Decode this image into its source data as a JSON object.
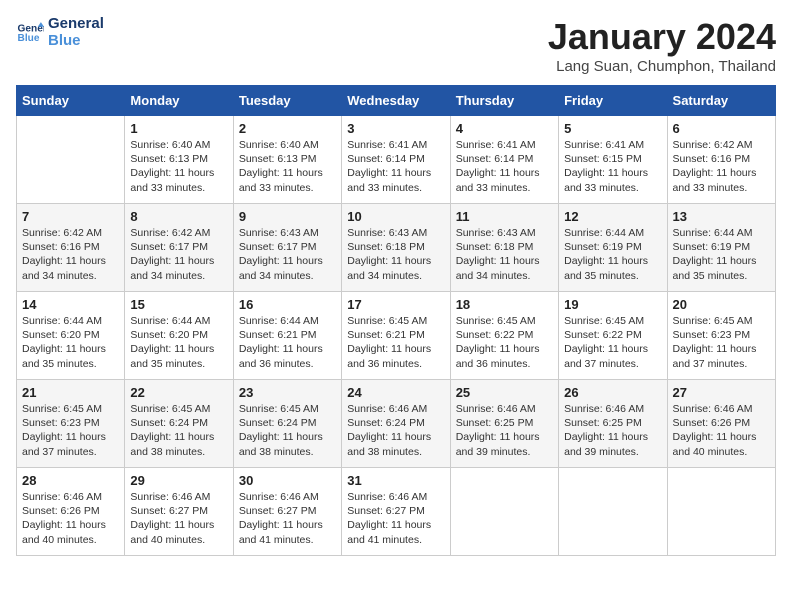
{
  "header": {
    "logo_line1": "General",
    "logo_line2": "Blue",
    "month_year": "January 2024",
    "location": "Lang Suan, Chumphon, Thailand"
  },
  "weekdays": [
    "Sunday",
    "Monday",
    "Tuesday",
    "Wednesday",
    "Thursday",
    "Friday",
    "Saturday"
  ],
  "weeks": [
    [
      {
        "day": "",
        "text": ""
      },
      {
        "day": "1",
        "text": "Sunrise: 6:40 AM\nSunset: 6:13 PM\nDaylight: 11 hours\nand 33 minutes."
      },
      {
        "day": "2",
        "text": "Sunrise: 6:40 AM\nSunset: 6:13 PM\nDaylight: 11 hours\nand 33 minutes."
      },
      {
        "day": "3",
        "text": "Sunrise: 6:41 AM\nSunset: 6:14 PM\nDaylight: 11 hours\nand 33 minutes."
      },
      {
        "day": "4",
        "text": "Sunrise: 6:41 AM\nSunset: 6:14 PM\nDaylight: 11 hours\nand 33 minutes."
      },
      {
        "day": "5",
        "text": "Sunrise: 6:41 AM\nSunset: 6:15 PM\nDaylight: 11 hours\nand 33 minutes."
      },
      {
        "day": "6",
        "text": "Sunrise: 6:42 AM\nSunset: 6:16 PM\nDaylight: 11 hours\nand 33 minutes."
      }
    ],
    [
      {
        "day": "7",
        "text": "Sunrise: 6:42 AM\nSunset: 6:16 PM\nDaylight: 11 hours\nand 34 minutes."
      },
      {
        "day": "8",
        "text": "Sunrise: 6:42 AM\nSunset: 6:17 PM\nDaylight: 11 hours\nand 34 minutes."
      },
      {
        "day": "9",
        "text": "Sunrise: 6:43 AM\nSunset: 6:17 PM\nDaylight: 11 hours\nand 34 minutes."
      },
      {
        "day": "10",
        "text": "Sunrise: 6:43 AM\nSunset: 6:18 PM\nDaylight: 11 hours\nand 34 minutes."
      },
      {
        "day": "11",
        "text": "Sunrise: 6:43 AM\nSunset: 6:18 PM\nDaylight: 11 hours\nand 34 minutes."
      },
      {
        "day": "12",
        "text": "Sunrise: 6:44 AM\nSunset: 6:19 PM\nDaylight: 11 hours\nand 35 minutes."
      },
      {
        "day": "13",
        "text": "Sunrise: 6:44 AM\nSunset: 6:19 PM\nDaylight: 11 hours\nand 35 minutes."
      }
    ],
    [
      {
        "day": "14",
        "text": "Sunrise: 6:44 AM\nSunset: 6:20 PM\nDaylight: 11 hours\nand 35 minutes."
      },
      {
        "day": "15",
        "text": "Sunrise: 6:44 AM\nSunset: 6:20 PM\nDaylight: 11 hours\nand 35 minutes."
      },
      {
        "day": "16",
        "text": "Sunrise: 6:44 AM\nSunset: 6:21 PM\nDaylight: 11 hours\nand 36 minutes."
      },
      {
        "day": "17",
        "text": "Sunrise: 6:45 AM\nSunset: 6:21 PM\nDaylight: 11 hours\nand 36 minutes."
      },
      {
        "day": "18",
        "text": "Sunrise: 6:45 AM\nSunset: 6:22 PM\nDaylight: 11 hours\nand 36 minutes."
      },
      {
        "day": "19",
        "text": "Sunrise: 6:45 AM\nSunset: 6:22 PM\nDaylight: 11 hours\nand 37 minutes."
      },
      {
        "day": "20",
        "text": "Sunrise: 6:45 AM\nSunset: 6:23 PM\nDaylight: 11 hours\nand 37 minutes."
      }
    ],
    [
      {
        "day": "21",
        "text": "Sunrise: 6:45 AM\nSunset: 6:23 PM\nDaylight: 11 hours\nand 37 minutes."
      },
      {
        "day": "22",
        "text": "Sunrise: 6:45 AM\nSunset: 6:24 PM\nDaylight: 11 hours\nand 38 minutes."
      },
      {
        "day": "23",
        "text": "Sunrise: 6:45 AM\nSunset: 6:24 PM\nDaylight: 11 hours\nand 38 minutes."
      },
      {
        "day": "24",
        "text": "Sunrise: 6:46 AM\nSunset: 6:24 PM\nDaylight: 11 hours\nand 38 minutes."
      },
      {
        "day": "25",
        "text": "Sunrise: 6:46 AM\nSunset: 6:25 PM\nDaylight: 11 hours\nand 39 minutes."
      },
      {
        "day": "26",
        "text": "Sunrise: 6:46 AM\nSunset: 6:25 PM\nDaylight: 11 hours\nand 39 minutes."
      },
      {
        "day": "27",
        "text": "Sunrise: 6:46 AM\nSunset: 6:26 PM\nDaylight: 11 hours\nand 40 minutes."
      }
    ],
    [
      {
        "day": "28",
        "text": "Sunrise: 6:46 AM\nSunset: 6:26 PM\nDaylight: 11 hours\nand 40 minutes."
      },
      {
        "day": "29",
        "text": "Sunrise: 6:46 AM\nSunset: 6:27 PM\nDaylight: 11 hours\nand 40 minutes."
      },
      {
        "day": "30",
        "text": "Sunrise: 6:46 AM\nSunset: 6:27 PM\nDaylight: 11 hours\nand 41 minutes."
      },
      {
        "day": "31",
        "text": "Sunrise: 6:46 AM\nSunset: 6:27 PM\nDaylight: 11 hours\nand 41 minutes."
      },
      {
        "day": "",
        "text": ""
      },
      {
        "day": "",
        "text": ""
      },
      {
        "day": "",
        "text": ""
      }
    ]
  ]
}
